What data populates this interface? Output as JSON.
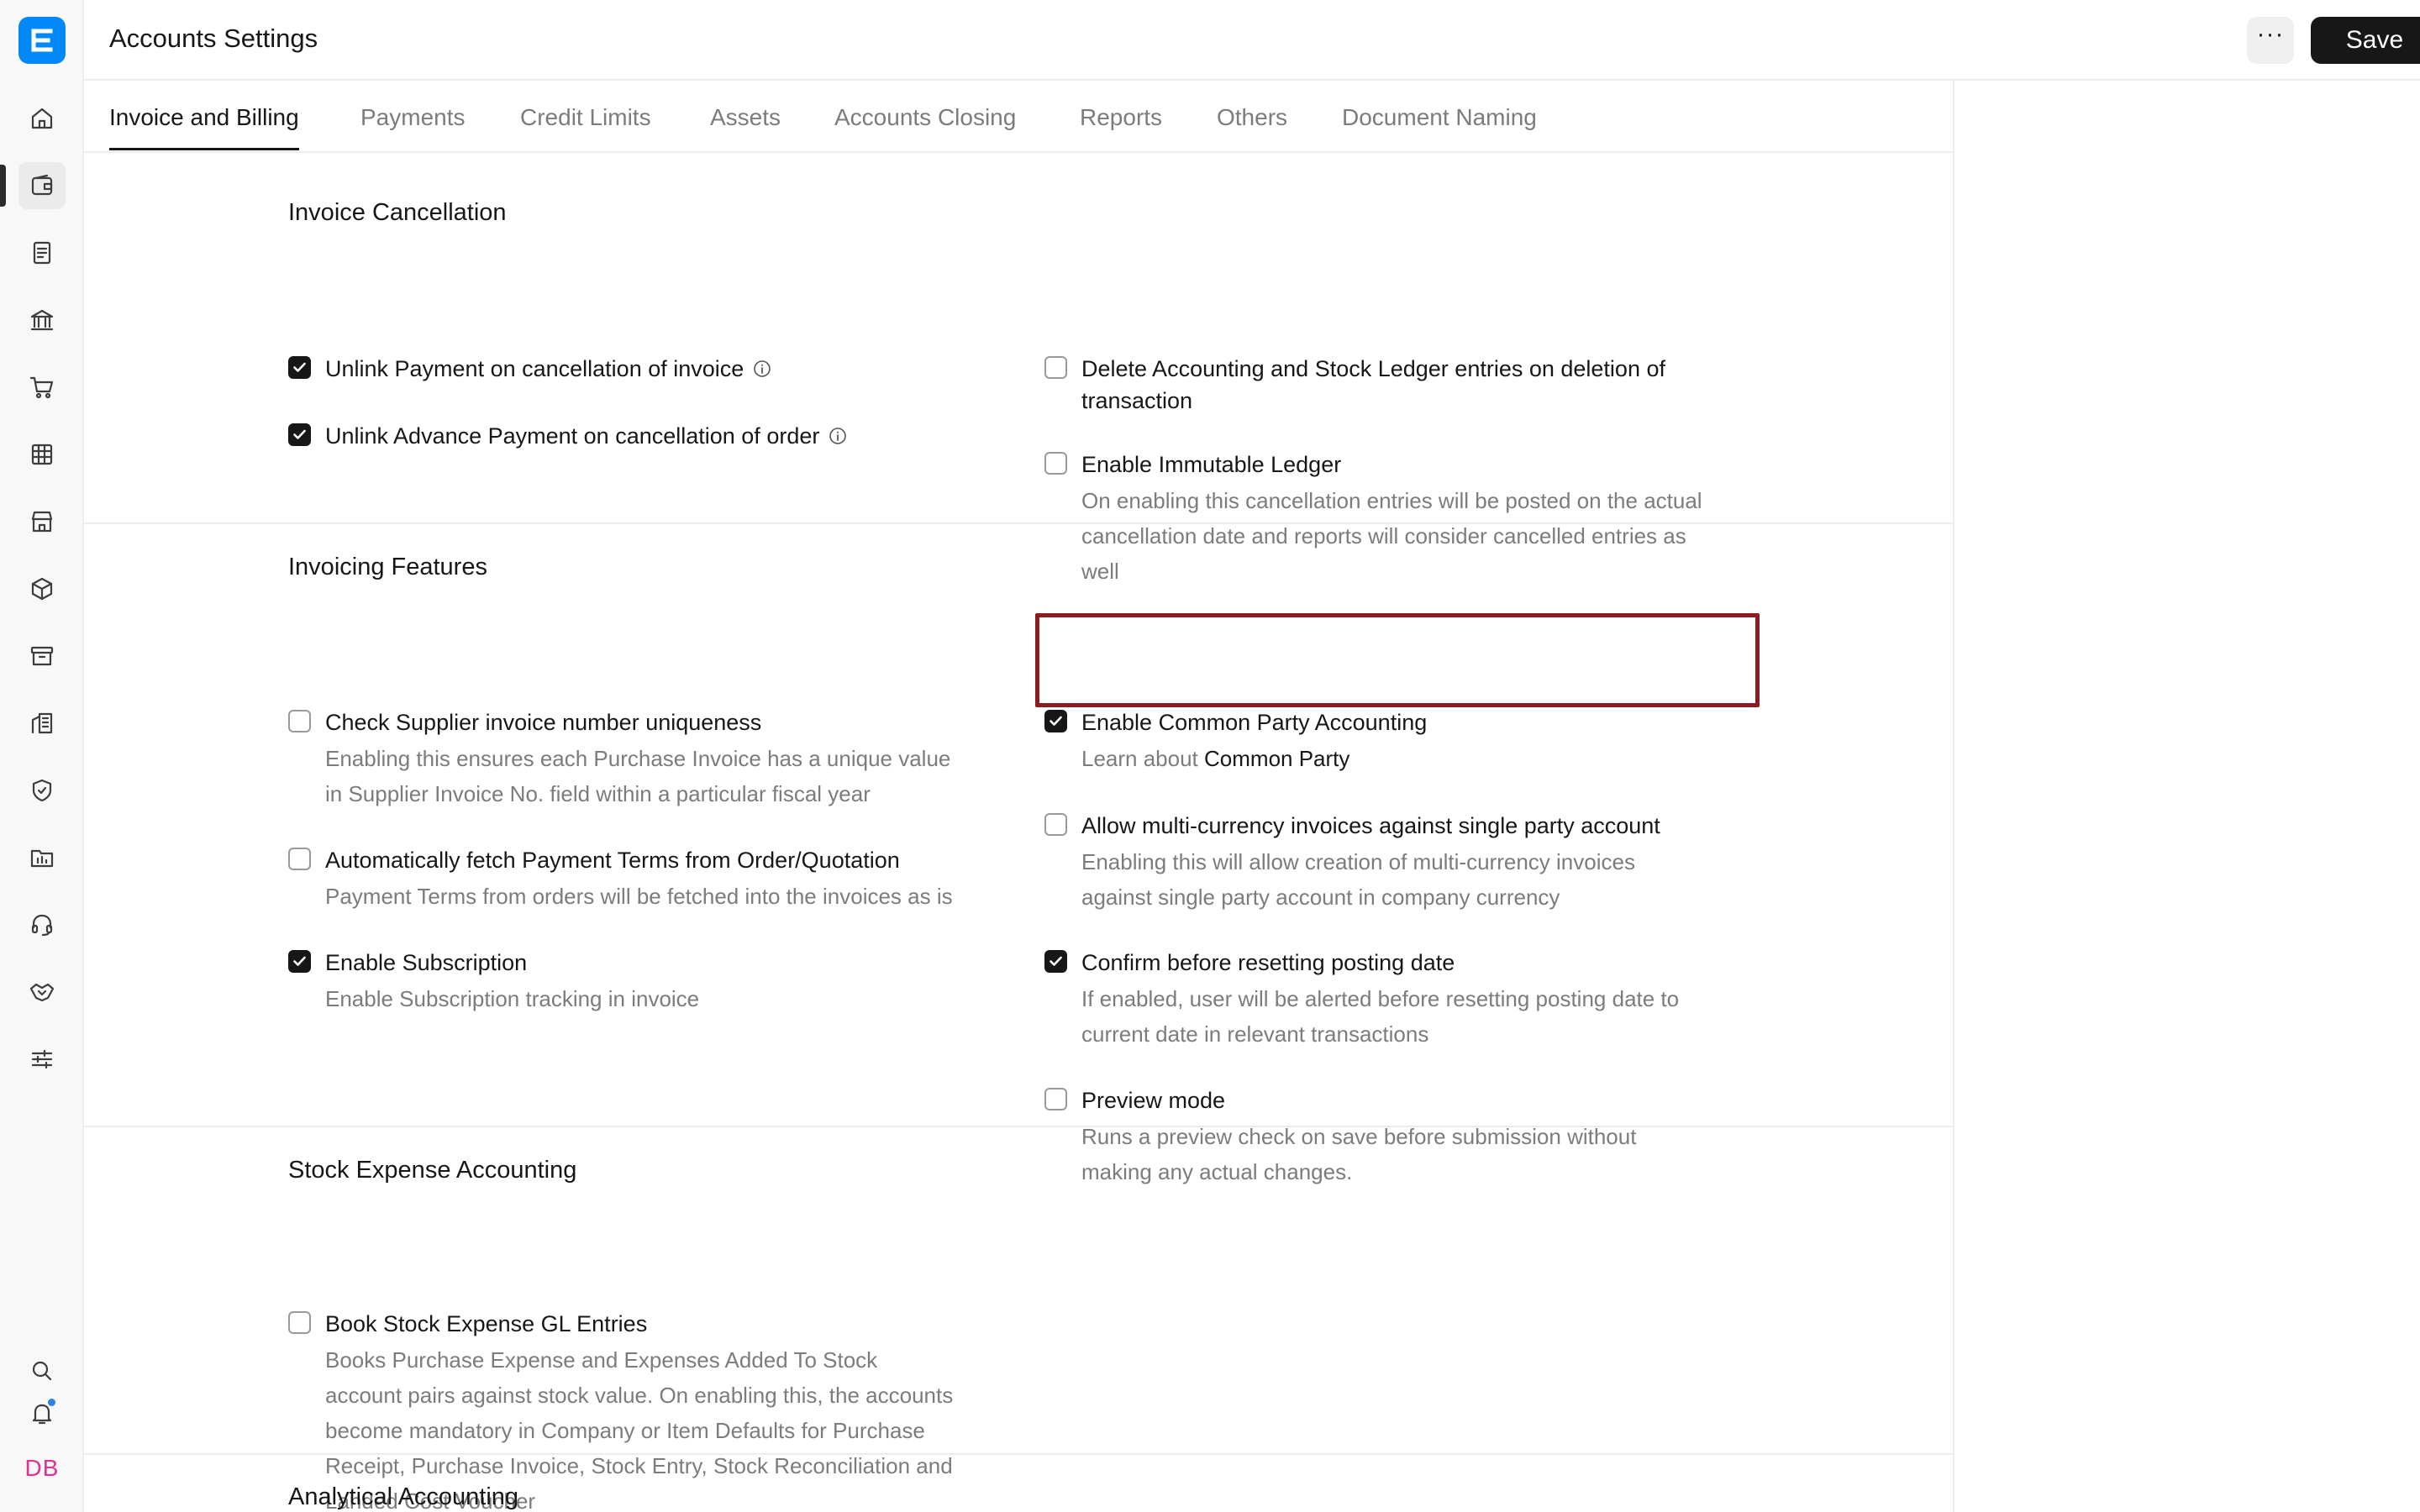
{
  "header": {
    "title": "Accounts Settings",
    "more_label": "···",
    "save_label": "Save"
  },
  "sidebar": {
    "logo": "E",
    "items": [
      {
        "icon": "home-icon"
      },
      {
        "icon": "wallet-icon"
      },
      {
        "icon": "document-icon"
      },
      {
        "icon": "bank-icon"
      },
      {
        "icon": "cart-icon"
      },
      {
        "icon": "table-icon"
      },
      {
        "icon": "store-icon"
      },
      {
        "icon": "package-icon"
      },
      {
        "icon": "archive-icon"
      },
      {
        "icon": "building-icon"
      },
      {
        "icon": "shield-icon"
      },
      {
        "icon": "folder-chart-icon"
      },
      {
        "icon": "headset-icon"
      },
      {
        "icon": "handshake-icon"
      },
      {
        "icon": "sliders-icon"
      }
    ],
    "bottom": {
      "search_icon": "search-icon",
      "bell_icon": "bell-icon",
      "avatar": "DB"
    }
  },
  "tabs": [
    "Invoice and Billing",
    "Payments",
    "Credit Limits",
    "Assets",
    "Accounts Closing",
    "Reports",
    "Others",
    "Document Naming"
  ],
  "active_tab": "Invoice and Billing",
  "sections": {
    "invoice_cancellation": {
      "title": "Invoice Cancellation",
      "unlink_payment": {
        "label": "Unlink Payment on cancellation of invoice",
        "checked": true
      },
      "unlink_advance": {
        "label": "Unlink Advance Payment on cancellation of order",
        "checked": true
      },
      "delete_entries": {
        "label_line1": "Delete Accounting and Stock Ledger entries on deletion of",
        "label_line2": "transaction",
        "checked": false
      },
      "immutable_ledger": {
        "label": "Enable Immutable Ledger",
        "checked": false,
        "desc_line1": "On enabling this cancellation entries will be posted on the actual",
        "desc_line2": "cancellation date and reports will consider cancelled entries as",
        "desc_line3": "well"
      }
    },
    "invoicing_features": {
      "title": "Invoicing Features",
      "supplier_uniqueness": {
        "label": "Check Supplier invoice number uniqueness",
        "checked": false,
        "desc_line1": "Enabling this ensures each Purchase Invoice has a unique value",
        "desc_line2": "in Supplier Invoice No. field within a particular fiscal year"
      },
      "fetch_terms": {
        "label": "Automatically fetch Payment Terms from Order/Quotation",
        "checked": false,
        "desc_line1": "Payment Terms from orders will be fetched into the invoices as is"
      },
      "subscription": {
        "label": "Enable Subscription",
        "checked": true,
        "desc_line1": "Enable Subscription tracking in invoice"
      },
      "common_party": {
        "label": "Enable Common Party Accounting",
        "checked": true,
        "desc_prefix": "Learn about ",
        "desc_link": "Common Party"
      },
      "multi_currency": {
        "label": "Allow multi-currency invoices against single party account",
        "checked": false,
        "desc_line1": "Enabling this will allow creation of multi-currency invoices",
        "desc_line2": "against single party account in company currency"
      },
      "confirm_reset": {
        "label": "Confirm before resetting posting date",
        "checked": true,
        "desc_line1": "If enabled, user will be alerted before resetting posting date to",
        "desc_line2": "current date in relevant transactions"
      },
      "preview_mode": {
        "label": "Preview mode",
        "checked": false,
        "desc_line1": "Runs a preview check on save before submission without",
        "desc_line2": "making any actual changes."
      }
    },
    "stock_expense": {
      "title": "Stock Expense Accounting",
      "book_gl": {
        "label": "Book Stock Expense GL Entries",
        "checked": false,
        "desc_line1": "Books Purchase Expense and Expenses Added To Stock",
        "desc_line2": "account pairs against stock value. On enabling this, the accounts",
        "desc_line3": "become mandatory in Company or Item Defaults for Purchase",
        "desc_line4": "Receipt, Purchase Invoice, Stock Entry, Stock Reconciliation and",
        "desc_line5": "Landed Cost Voucher"
      }
    },
    "analytical": {
      "title": "Analytical Accounting"
    }
  },
  "colors": {
    "accent": "#0289f7",
    "highlight": "#8e1b22",
    "avatar": "#e0338f",
    "notification": "#2f80ed"
  }
}
